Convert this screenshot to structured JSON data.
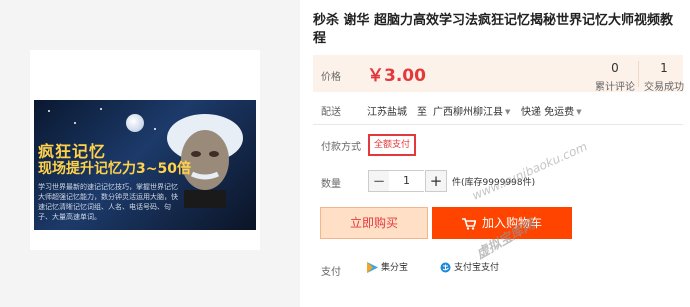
{
  "product": {
    "title": "秒杀 谢华 超脑力高效学习法疯狂记忆揭秘世界记忆大师视频教程",
    "image": {
      "title": "疯狂记忆",
      "subtitle": "现场提升记忆力3~50倍",
      "description": "学习世界最新的速记记忆技巧，掌握世界记忆大师超强记忆能力，数分钟灵活运用大脑，快速记忆清晰记忆词组、人名、电话号码、句子、大量高速单词。"
    }
  },
  "price": {
    "label": "价格",
    "value": "￥3.00",
    "reviews_count": "0",
    "reviews_label": "累计评论",
    "deals_count": "1",
    "deals_label": "交易成功"
  },
  "shipping": {
    "label": "配送",
    "from": "江苏盐城",
    "to_word": "至",
    "destination": "广西柳州柳江县",
    "method": "快递 免运费"
  },
  "payment_method": {
    "label": "付款方式",
    "option": "全额支付"
  },
  "quantity": {
    "label": "数量",
    "minus": "−",
    "value": "1",
    "plus": "+",
    "stock": "件(库存9999998件)"
  },
  "actions": {
    "buy_now": "立即购买",
    "add_to_cart": "加入购物车"
  },
  "support": {
    "label": "支付",
    "methods": [
      "集分宝",
      "支付宝支付"
    ]
  },
  "watermarks": {
    "url": "www.xunibaoku.com",
    "site": "虚拟宝库网"
  },
  "colors": {
    "accent": "#e4393c",
    "cart": "#ff4400",
    "price_bg": "#fdf2ea"
  }
}
